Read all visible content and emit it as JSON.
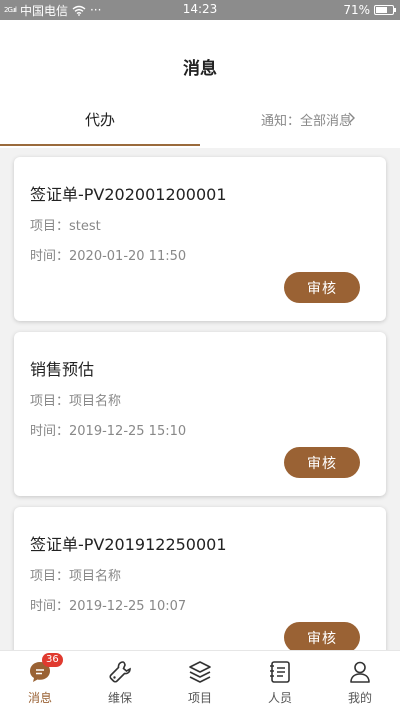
{
  "status_bar": {
    "signal": "2G.ııl",
    "carrier": "中国电信",
    "more": "···",
    "time": "14:23",
    "battery": "71%",
    "battery_level": 0.71
  },
  "header": {
    "title": "消息",
    "tabs": {
      "todo": "代办",
      "notice": "通知：全部消息"
    }
  },
  "cards": [
    {
      "title": "签证单-PV202001200001",
      "project": "项目：stest",
      "time": "时间：2020-01-20 11:50",
      "button": "审核"
    },
    {
      "title": "销售预估",
      "project": "项目：项目名称",
      "time": "时间：2019-12-25 15:10",
      "button": "审核"
    },
    {
      "title": "签证单-PV201912250001",
      "project": "项目：项目名称",
      "time": "时间：2019-12-25 10:07",
      "button": "审核"
    }
  ],
  "nav": {
    "badge": "36",
    "items": [
      {
        "label": "消息",
        "icon": "message-icon",
        "active": true
      },
      {
        "label": "维保",
        "icon": "wrench-icon"
      },
      {
        "label": "项目",
        "icon": "layers-icon"
      },
      {
        "label": "人员",
        "icon": "contacts-book-icon"
      },
      {
        "label": "我的",
        "icon": "user-icon"
      }
    ]
  },
  "colors": {
    "accent": "#9a6234",
    "badge": "#e03a2f",
    "status_bar": "#8c8c8c"
  }
}
